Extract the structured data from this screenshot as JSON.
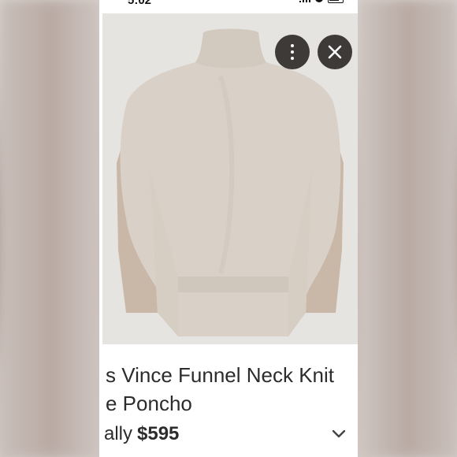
{
  "status_bar": {
    "time": "5:02"
  },
  "listing": {
    "title_line1": "s Vince Funnel Neck Knit",
    "title_line2": "e Poncho",
    "price_prefix": "ally",
    "price": "$595"
  },
  "icons": {
    "more": "more-vertical-icon",
    "close": "close-icon",
    "expand": "chevron-down-icon"
  },
  "colors": {
    "overlay_button": "#3d3a38",
    "poncho": "#d9d1c8",
    "text": "#2c2c2c"
  }
}
